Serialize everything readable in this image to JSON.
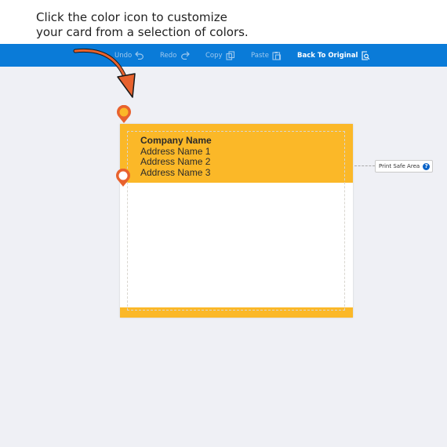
{
  "instruction": {
    "line1": "Click the color icon to customize",
    "line2": "your card from a selection of colors."
  },
  "toolbar": {
    "undo_label": "Undo",
    "redo_label": "Redo",
    "copy_label": "Copy",
    "paste_label": "Paste",
    "back_label": "Back To Original"
  },
  "card": {
    "company": "Company Name",
    "address1": "Address Name 1",
    "address2": "Address Name 2",
    "address3": "Address Name 3"
  },
  "print_safe": {
    "label": "Print Safe Area",
    "help_glyph": "?"
  },
  "colors": {
    "toolbar": "#0a7bd8",
    "card_accent": "#fbb828",
    "pin": "#e8622e"
  },
  "icons": {
    "undo": "undo-icon",
    "redo": "redo-icon",
    "copy": "copy-icon",
    "paste": "paste-icon",
    "back": "restore-icon",
    "color_pin": "color-picker-icon"
  }
}
